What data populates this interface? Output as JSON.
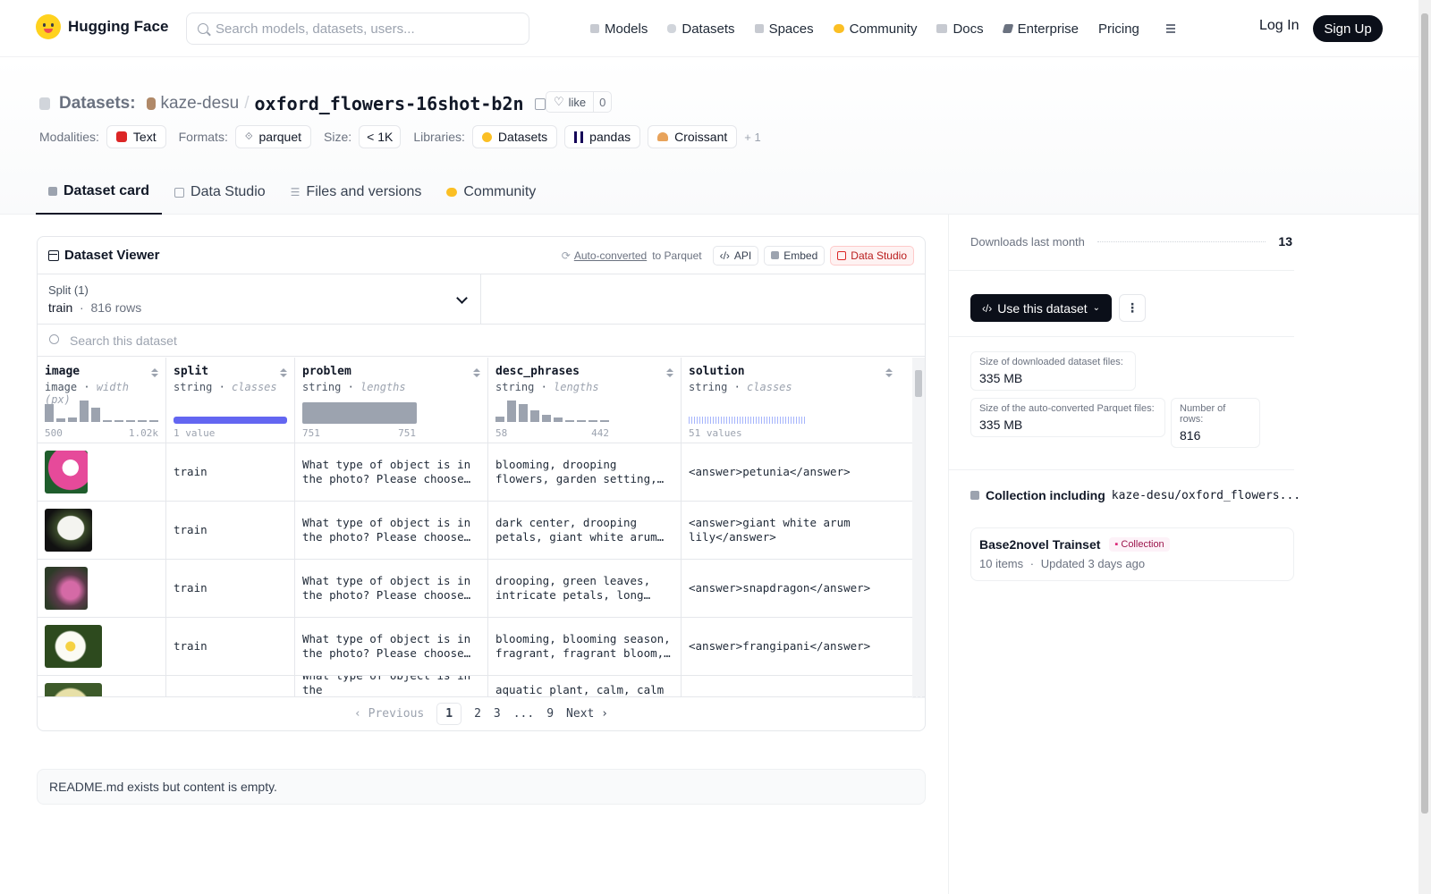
{
  "header": {
    "brand": "Hugging Face",
    "search_placeholder": "Search models, datasets, users...",
    "nav": [
      {
        "label": "Models",
        "icon": "cube-icon",
        "color": "#9ca3af"
      },
      {
        "label": "Datasets",
        "icon": "database-icon",
        "color": "#d1d5db"
      },
      {
        "label": "Spaces",
        "icon": "spaces-icon",
        "color": "#9ca3af"
      },
      {
        "label": "Community",
        "icon": "community-icon",
        "color": "#fbbf24"
      },
      {
        "label": "Docs",
        "icon": "book-icon",
        "color": "#9ca3af"
      },
      {
        "label": "Enterprise",
        "icon": "enterprise-icon",
        "color": "#6b7280"
      },
      {
        "label": "Pricing"
      }
    ],
    "login": "Log In",
    "signup": "Sign Up"
  },
  "repo": {
    "kind": "Datasets:",
    "owner": "kaze-desu",
    "separator": "/",
    "name": "oxford_flowers-16shot-b2n",
    "like_label": "like",
    "like_count": "0",
    "tags": {
      "modalities_label": "Modalities:",
      "modalities": [
        "Text"
      ],
      "formats_label": "Formats:",
      "formats": [
        "parquet"
      ],
      "size_label": "Size:",
      "size": [
        "< 1K"
      ],
      "libraries_label": "Libraries:",
      "libraries": [
        "Datasets",
        "pandas",
        "Croissant"
      ],
      "more": "+ 1"
    },
    "tabs": [
      "Dataset card",
      "Data Studio",
      "Files and versions",
      "Community"
    ]
  },
  "viewer": {
    "title": "Dataset Viewer",
    "auto_converted": "Auto-converted",
    "to_parquet": "to Parquet",
    "api": "API",
    "embed": "Embed",
    "data_studio": "Data Studio",
    "split_label": "Split (1)",
    "split_value": "train",
    "split_rows": "816 rows",
    "search_placeholder": "Search this dataset",
    "columns": [
      {
        "name": "image",
        "type": "image",
        "stat": "width (px)",
        "min": "500",
        "max": "1.02k"
      },
      {
        "name": "split",
        "type": "string",
        "stat": "classes",
        "min": "1 value",
        "max": ""
      },
      {
        "name": "problem",
        "type": "string",
        "stat": "lengths",
        "min": "751",
        "max": "751"
      },
      {
        "name": "desc_phrases",
        "type": "string",
        "stat": "lengths",
        "min": "58",
        "max": "442"
      },
      {
        "name": "solution",
        "type": "string",
        "stat": "classes",
        "min": "51 values",
        "max": ""
      }
    ],
    "rows": [
      {
        "split": "train",
        "problem": "What type of object is in the photo? Please choose one from the list",
        "desc": "blooming, drooping flowers, garden setting, glossy leaves",
        "solution": "<answer>petunia</answer>"
      },
      {
        "split": "train",
        "problem": "What type of object is in the photo? Please choose one from the list",
        "desc": "dark center, drooping petals, giant white arum lily, glossy leaves",
        "solution": "<answer>giant white arum lily</answer>"
      },
      {
        "split": "train",
        "problem": "What type of object is in the photo? Please choose one from the list",
        "desc": "drooping, green leaves, intricate petals, long spur, pink",
        "solution": "<answer>snapdragon</answer>"
      },
      {
        "split": "train",
        "problem": "What type of object is in the photo? Please choose one from the list",
        "desc": "blooming, blooming season, fragrant, fragrant bloom, white",
        "solution": "<answer>frangipani</answer>"
      },
      {
        "split": "",
        "problem": "What type of object is in the",
        "desc": "aquatic plant, calm, calm",
        "solution": ""
      }
    ],
    "pager": {
      "prev": "Previous",
      "pages": [
        "1",
        "2",
        "3",
        "...",
        "9"
      ],
      "next": "Next"
    }
  },
  "readme": "README.md exists but content is empty.",
  "sidebar": {
    "downloads_label": "Downloads last month",
    "downloads_value": "13",
    "use_button": "Use this dataset",
    "more": "⋮",
    "stats": [
      {
        "label": "Size of downloaded dataset files:",
        "value": "335 MB"
      },
      {
        "label": "Size of the auto-converted Parquet files:",
        "value": "335 MB"
      },
      {
        "label": "Number of rows:",
        "value": "816"
      }
    ],
    "collection_label": "Collection including",
    "collection_repo": "kaze-desu/oxford_flowers...",
    "collection": {
      "title": "Base2novel Trainset",
      "badge": "Collection",
      "items": "10 items",
      "dot": "·",
      "updated": "Updated 3 days ago"
    }
  }
}
